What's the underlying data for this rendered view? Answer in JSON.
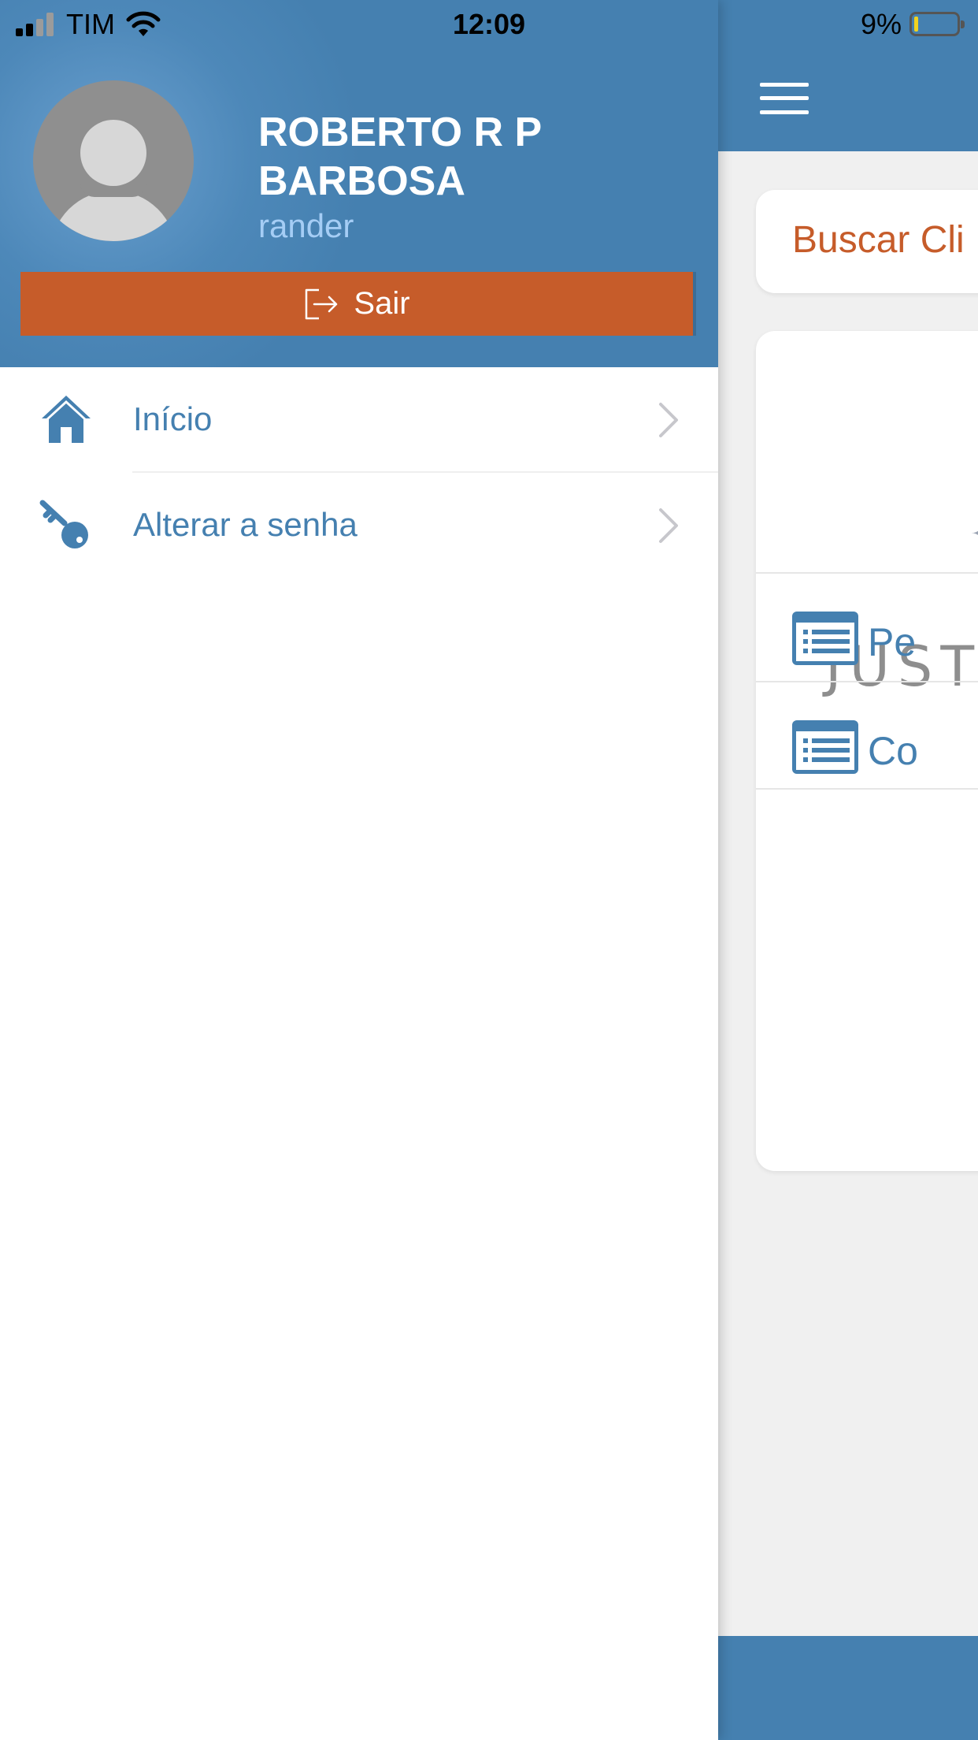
{
  "status_bar": {
    "carrier": "TIM",
    "time": "12:09",
    "battery": "9%",
    "battery_level": 0.09
  },
  "drawer": {
    "user": {
      "name": "ROBERTO R P BARBOSA",
      "login": "rander"
    },
    "logout_label": "Sair",
    "items": [
      {
        "label": "Início",
        "icon": "home-icon"
      },
      {
        "label": "Alterar a senha",
        "icon": "key-icon"
      }
    ]
  },
  "main": {
    "search_label": "Buscar Cli",
    "logo_text": "JUST",
    "menu": [
      {
        "label": "Pe",
        "icon": "list-icon"
      },
      {
        "label": "Co",
        "icon": "list-icon"
      }
    ]
  },
  "colors": {
    "primary": "#4580b0",
    "accent": "#c65c2a",
    "login_text": "#a5cdf5"
  }
}
